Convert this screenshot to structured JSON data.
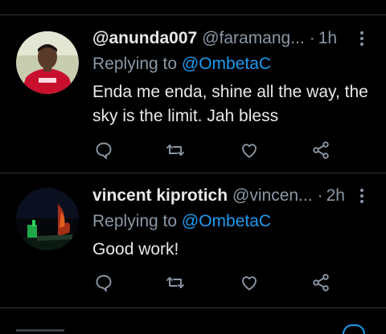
{
  "tweets": [
    {
      "display_name": "@anunda007",
      "handle": "@faramang...",
      "separator": "·",
      "time": "1h",
      "replying_prefix": "Replying to ",
      "replying_to": "@OmbetaC",
      "text": "Enda me enda, shine all the way, the sky is the limit. Jah bless",
      "avatar_icon": "profile-photo-red-jersey"
    },
    {
      "display_name": "vincent kiprotich",
      "handle": "@vincen...",
      "separator": "·",
      "time": "2h",
      "replying_prefix": "Replying to ",
      "replying_to": "@OmbetaC",
      "text": "Good work!",
      "avatar_icon": "profile-photo-night-scene"
    }
  ],
  "icons": {
    "reply": "reply-icon",
    "retweet": "retweet-icon",
    "like": "heart-icon",
    "share": "share-icon",
    "more": "more-vertical-icon"
  },
  "colors": {
    "background": "#000000",
    "text": "#e7e9ea",
    "secondary": "#8b98a5",
    "accent": "#1d9bf0",
    "divider": "#2f3336"
  }
}
